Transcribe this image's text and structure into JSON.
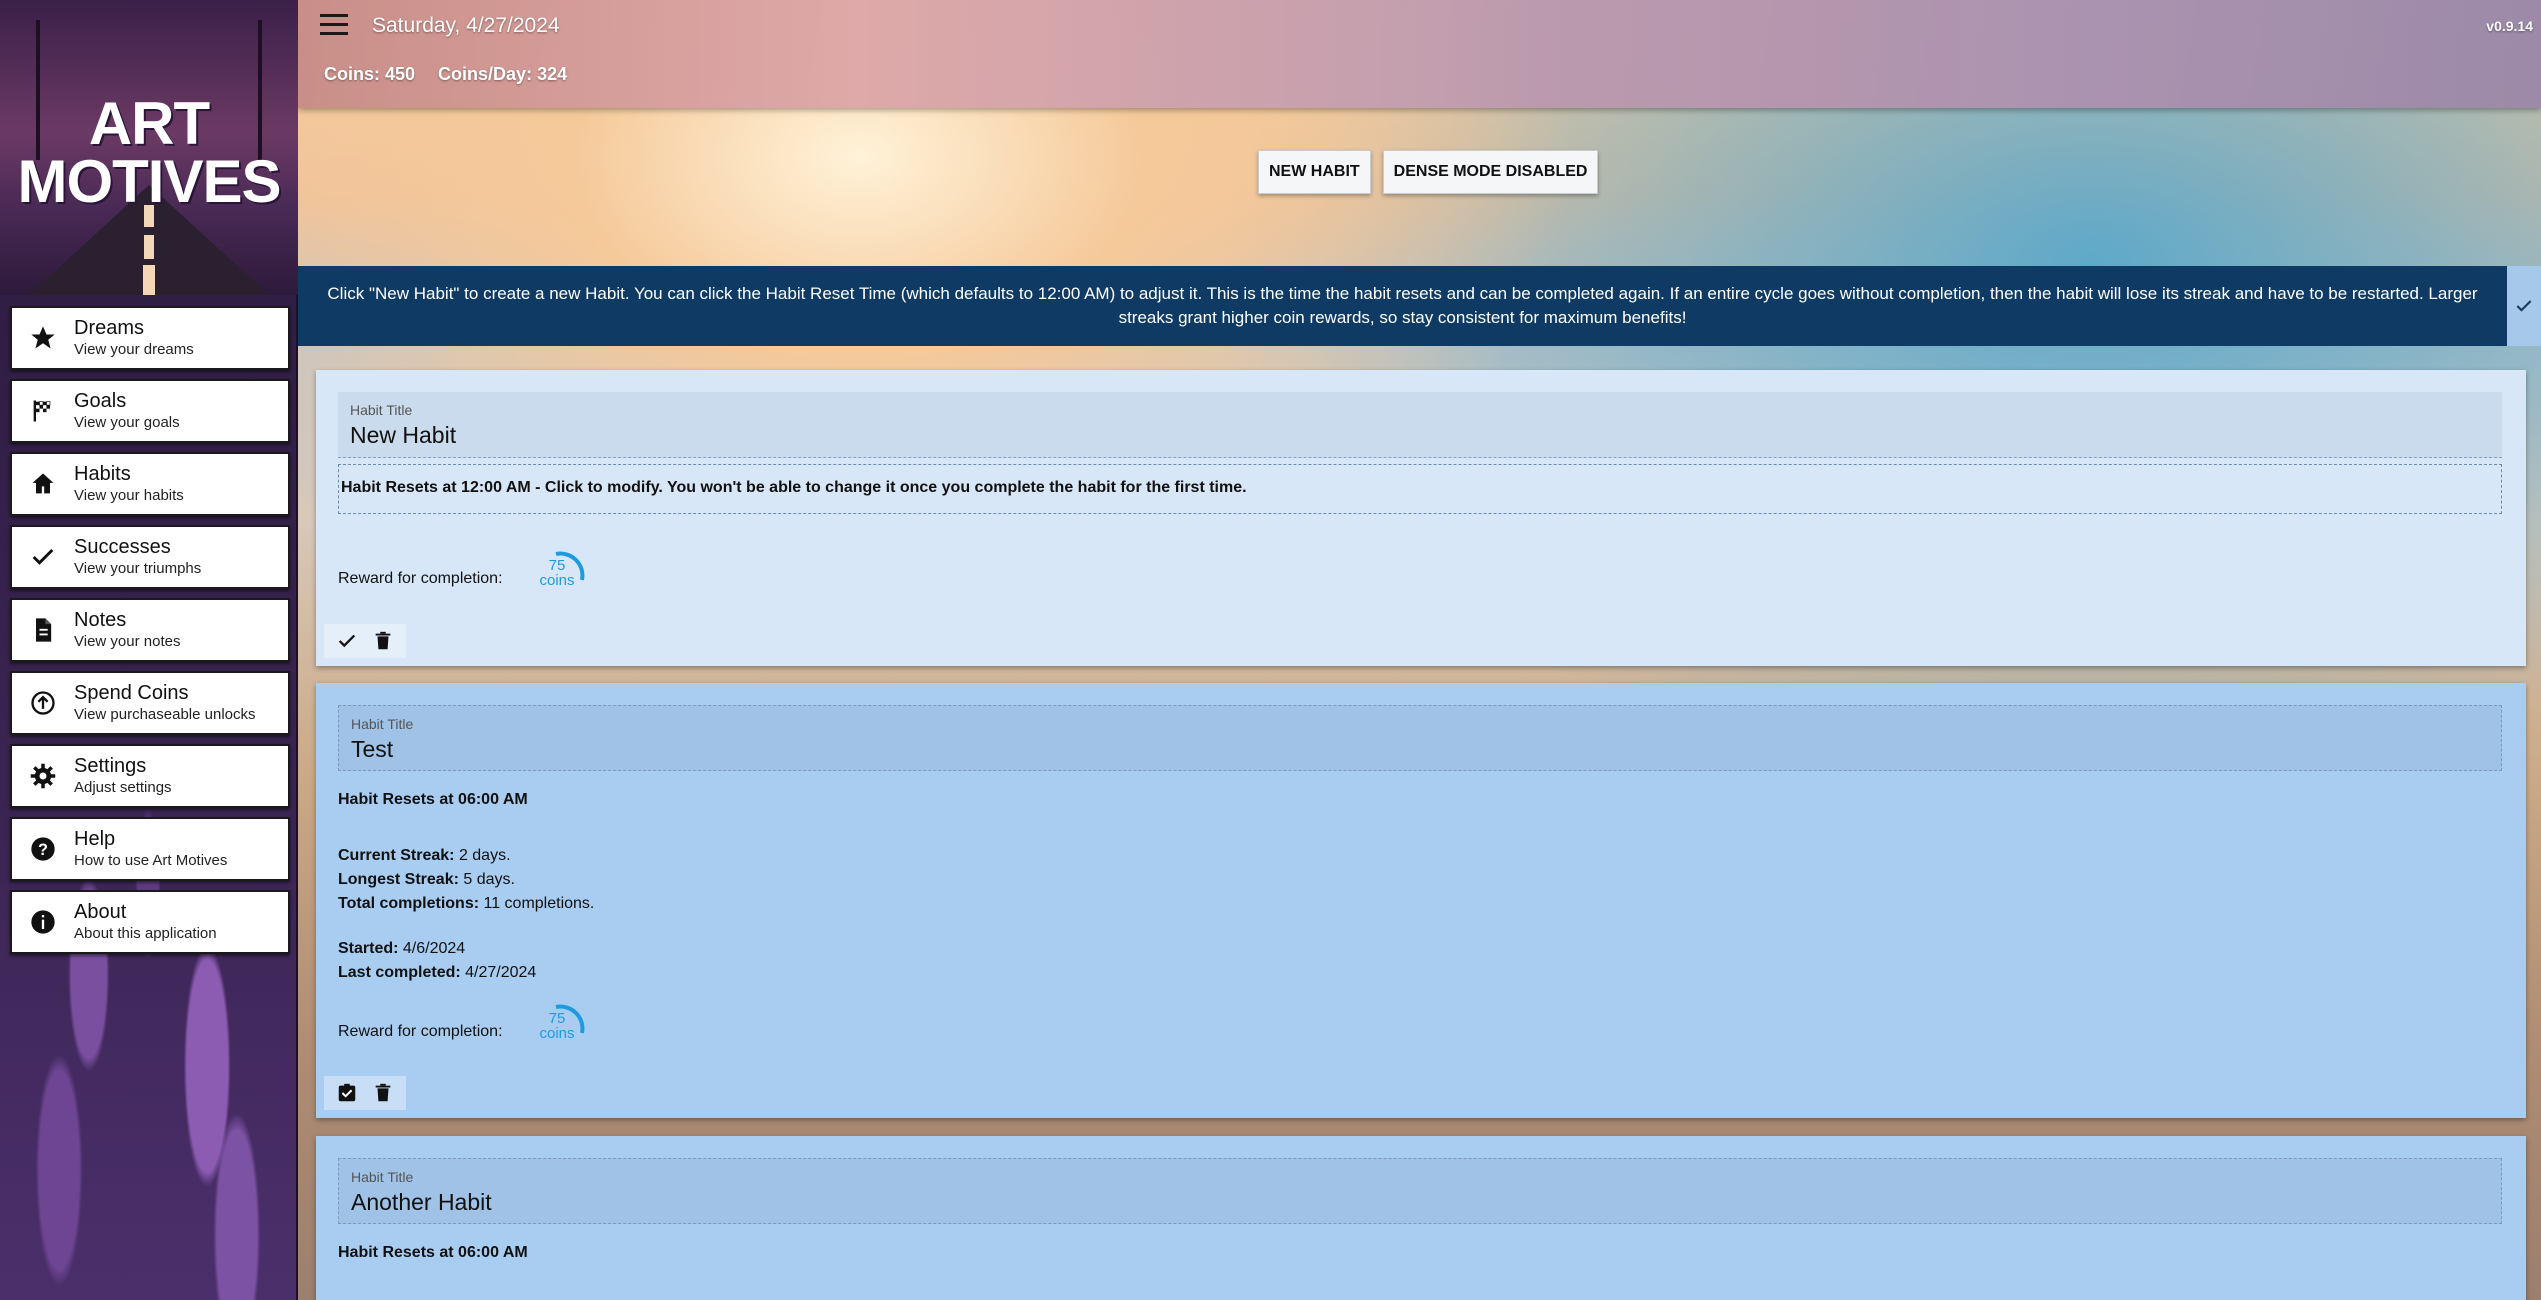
{
  "app": {
    "logo_line1": "ART",
    "logo_line2": "MOTIVES",
    "version": "v0.9.14"
  },
  "header": {
    "date": "Saturday, 4/27/2024",
    "coins": "Coins: 450",
    "coins_per_day": "Coins/Day: 324"
  },
  "sidebar": {
    "items": [
      {
        "title": "Dreams",
        "subtitle": "View your dreams",
        "icon": "star-icon"
      },
      {
        "title": "Goals",
        "subtitle": "View your goals",
        "icon": "checkered-flag-icon"
      },
      {
        "title": "Habits",
        "subtitle": "View your habits",
        "icon": "home-icon"
      },
      {
        "title": "Successes",
        "subtitle": "View your triumphs",
        "icon": "checkmark-icon"
      },
      {
        "title": "Notes",
        "subtitle": "View your notes",
        "icon": "document-icon"
      },
      {
        "title": "Spend Coins",
        "subtitle": "View purchaseable unlocks",
        "icon": "arrow-up-circle-icon"
      },
      {
        "title": "Settings",
        "subtitle": "Adjust settings",
        "icon": "gear-icon"
      },
      {
        "title": "Help",
        "subtitle": "How to use Art Motives",
        "icon": "help-circle-icon"
      },
      {
        "title": "About",
        "subtitle": "About this application",
        "icon": "info-circle-icon"
      }
    ]
  },
  "toolbar": {
    "new_habit": "NEW HABIT",
    "dense_mode": "DENSE MODE DISABLED"
  },
  "banner": {
    "text": "Click \"New Habit\" to create a new Habit. You can click the Habit Reset Time (which defaults to 12:00 AM) to adjust it. This is the time the habit resets and can be completed again. If an entire cycle goes without completion, then the habit will lose its streak and have to be restarted. Larger streaks grant higher coin rewards, so stay consistent for maximum benefits!"
  },
  "habits": [
    {
      "title_label": "Habit Title",
      "title": "New Habit",
      "reset": "Habit Resets at 12:00 AM - Click to modify. You won't be able to change it once you complete the habit for the first time.",
      "reward_label": "Reward for completion:",
      "reward_amount": "75",
      "reward_unit": "coins"
    },
    {
      "title_label": "Habit Title",
      "title": "Test",
      "reset": "Habit Resets at 06:00 AM",
      "current_streak_label": "Current Streak:",
      "current_streak": "2 days.",
      "longest_streak_label": "Longest Streak:",
      "longest_streak": "5 days.",
      "total_label": "Total completions:",
      "total": "11 completions.",
      "started_label": "Started:",
      "started": "4/6/2024",
      "last_label": "Last completed:",
      "last": "4/27/2024",
      "reward_label": "Reward for completion:",
      "reward_amount": "75",
      "reward_unit": "coins"
    },
    {
      "title_label": "Habit Title",
      "title": "Another Habit",
      "reset": "Habit Resets at 06:00 AM"
    }
  ]
}
